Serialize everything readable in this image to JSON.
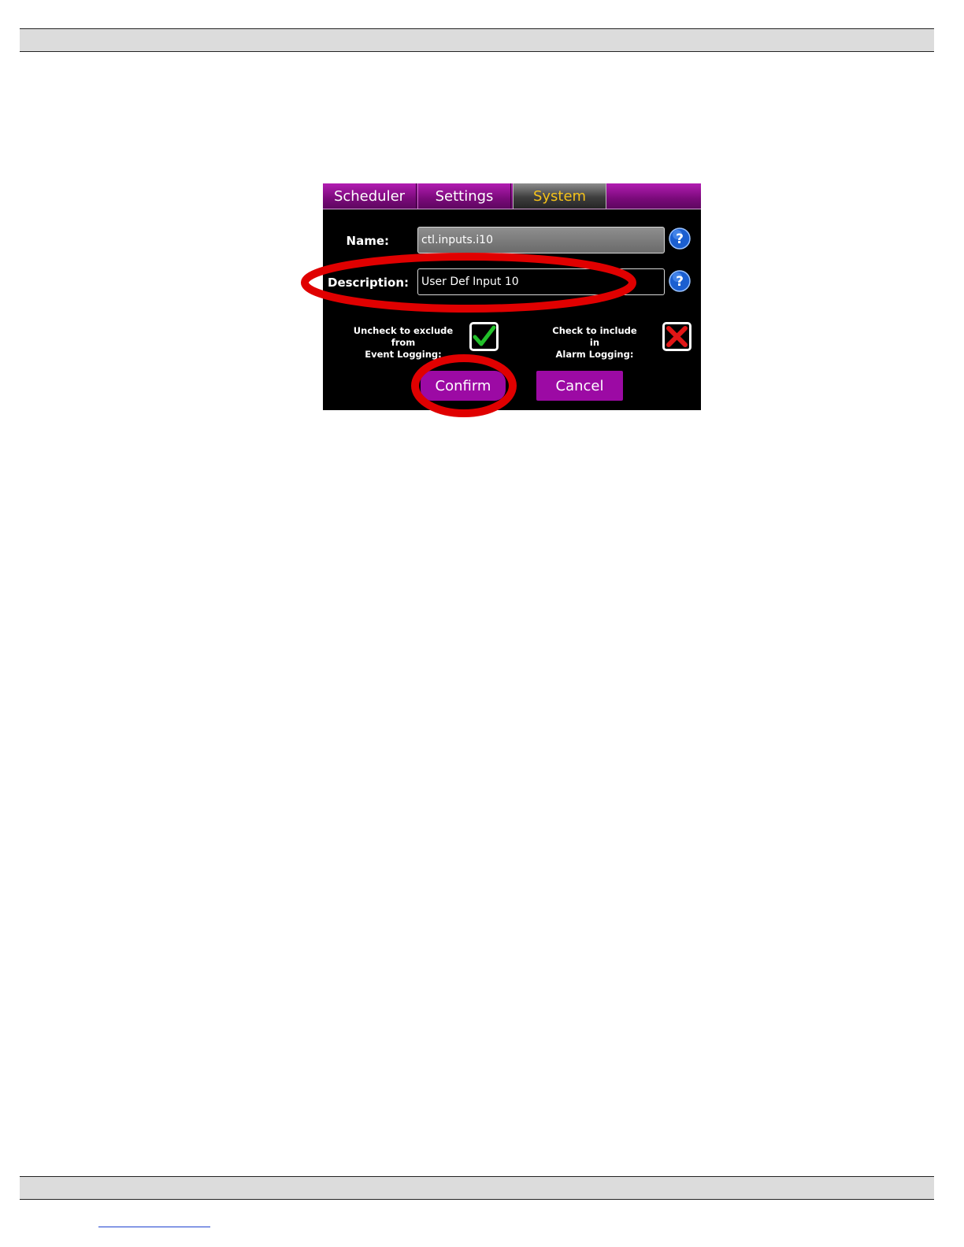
{
  "tabs": [
    {
      "label": "Scheduler"
    },
    {
      "label": "Settings"
    },
    {
      "label": "System",
      "active": true
    }
  ],
  "form": {
    "name_label": "Name:",
    "name_value": "ctl.inputs.i10",
    "description_label": "Description:",
    "description_value": "User Def Input 10",
    "event_logging_label_line1": "Uncheck to exclude from",
    "event_logging_label_line2": "Event Logging:",
    "event_logging_checked": true,
    "alarm_logging_label_line1": "Check to include in",
    "alarm_logging_label_line2": "Alarm Logging:",
    "alarm_logging_checked": false
  },
  "buttons": {
    "confirm_label": "Confirm",
    "cancel_label": "Cancel"
  },
  "colors": {
    "accent": "#9c0aa4",
    "active_tab_text": "#f5c21a",
    "highlight_ring": "#e00000",
    "check_green": "#22c02a",
    "cross_red": "#e01616"
  },
  "icons": {
    "help": "help-icon",
    "check": "checkmark-icon",
    "cross": "x-icon"
  }
}
